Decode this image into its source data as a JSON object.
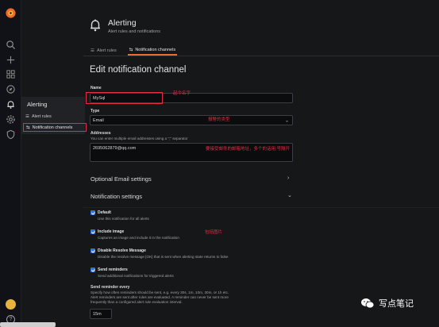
{
  "header": {
    "title": "Alerting",
    "subtitle": "Alert rules and notifications"
  },
  "tabs": [
    {
      "label": "Alert rules",
      "icon": "list-icon"
    },
    {
      "label": "Notification channels",
      "icon": "exchange-icon"
    }
  ],
  "sidebar": {
    "menu_title": "Alerting",
    "items": [
      {
        "label": "Alert rules"
      },
      {
        "label": "Notification channels"
      }
    ]
  },
  "form": {
    "page_title": "Edit notification channel",
    "name_label": "Name",
    "name_value": "MySql",
    "type_label": "Type",
    "type_value": "Email",
    "addresses_label": "Addresses",
    "addresses_desc": "You can enter multiple email addresses using a \";\" separator",
    "addresses_value": "2695062879@qq.com",
    "optional_section": "Optional Email settings",
    "notification_section": "Notification settings",
    "checkboxes": [
      {
        "label": "Default",
        "desc": "Use this notification for all alerts",
        "checked": true
      },
      {
        "label": "Include image",
        "desc": "Captures an image and include it in the notification",
        "checked": true
      },
      {
        "label": "Disable Resolve Message",
        "desc": "Disable the resolve message [OK] that is sent when alerting state returns to false",
        "checked": true
      },
      {
        "label": "Send reminders",
        "desc": "Send additional notifications for triggered alerts",
        "checked": true
      }
    ],
    "reminder_label": "Send reminder every",
    "reminder_desc_1": "Specify how often reminders should be sent, e.g. every 30s, 1m, 10m, 30m, or 1h etc.",
    "reminder_desc_2": "Alert reminders are sent after rules are evaluated. A reminder can never be sent more",
    "reminder_desc_3": "frequently than a configured alert rule evaluation interval.",
    "reminder_value": "15m"
  },
  "annotations": {
    "name_note": "起个名字",
    "type_note": "报警的类型",
    "address_note": "要接受邮件的邮箱地址，多个的话用;号隔开",
    "image_note": "包括图片"
  },
  "watermark": {
    "text": "写点笔记"
  },
  "colors": {
    "background": "#161719",
    "accent_tab": "#f26a2a",
    "checkbox": "#3871dc",
    "annotation_red": "#e02f44"
  }
}
